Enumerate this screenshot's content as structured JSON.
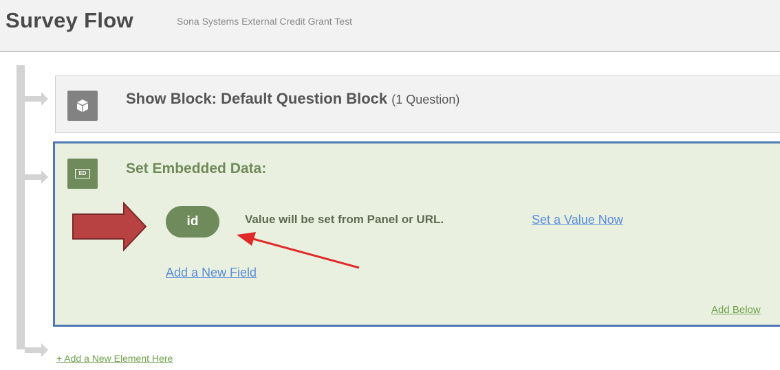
{
  "header": {
    "title": "Survey Flow",
    "subtitle": "Sona Systems External Credit Grant Test"
  },
  "flow": {
    "blocks": [
      {
        "icon": "cube-icon",
        "title": "Show Block: Default Question Block",
        "count": "(1 Question)"
      },
      {
        "icon": "embedded-data-icon",
        "icon_label": "ED",
        "title": "Set Embedded Data:",
        "field": {
          "name": "id",
          "description": "Value will be set from Panel or URL.",
          "set_value_label": "Set a Value Now"
        },
        "add_field_label": "Add a New Field",
        "add_below_label": "Add Below"
      }
    ],
    "add_element_label": "+ Add a New Element Here"
  },
  "colors": {
    "header_bg": "#f2f2f2",
    "block_bg": "#f2f2f2",
    "ed_block_bg": "#e9f0df",
    "ed_block_border": "#4d78b4",
    "ed_accent": "#6f8a5b",
    "link_blue": "#5b8dd9",
    "link_green": "#6fa04a",
    "annotation_arrow": "#b84141"
  },
  "annotations": [
    "block-arrow",
    "pointer-arrow"
  ]
}
